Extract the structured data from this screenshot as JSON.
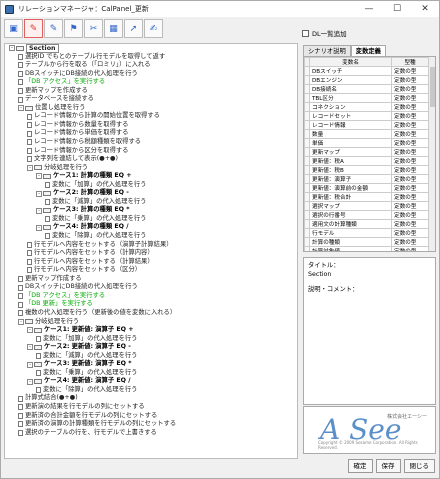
{
  "window": {
    "title": "リレーションマネージャ：CalPanel_更新",
    "ctrl_min": "—",
    "ctrl_max": "☐",
    "ctrl_close": "✕"
  },
  "toolbar": {
    "icons": [
      "folder",
      "record-red",
      "record",
      "flag",
      "tool",
      "grid",
      "cursor",
      "bookmark"
    ]
  },
  "tree": {
    "rows": [
      {
        "lvl": 0,
        "type": "sec",
        "text": "Section",
        "tog": "-"
      },
      {
        "lvl": 1,
        "type": "doc",
        "text": "選択ID でもとのテーブル行モデルを取得して返す"
      },
      {
        "lvl": 1,
        "type": "doc",
        "text": "テーブルから行を取る（「ロミリ」）に入れる"
      },
      {
        "lvl": 1,
        "type": "doc",
        "text": "DBスイッチにDB接続の代入処理を行う"
      },
      {
        "lvl": 1,
        "type": "doc",
        "text": "「DB アクセス」を実行する",
        "hl": true
      },
      {
        "lvl": 1,
        "type": "doc",
        "text": "更新マップを作成する"
      },
      {
        "lvl": 1,
        "type": "doc",
        "text": "データベースを接続する"
      },
      {
        "lvl": 1,
        "type": "fold",
        "text": "位置し処理を行う",
        "tog": "-"
      },
      {
        "lvl": 2,
        "type": "doc",
        "text": "レコード情報から計算の開始位置を取得する"
      },
      {
        "lvl": 2,
        "type": "doc",
        "text": "レコード情報から数量を取得する"
      },
      {
        "lvl": 2,
        "type": "doc",
        "text": "レコード情報から単価を取得する"
      },
      {
        "lvl": 2,
        "type": "doc",
        "text": "レコード情報から税額種類を取得する"
      },
      {
        "lvl": 2,
        "type": "doc",
        "text": "レコード情報から区分を取得する"
      },
      {
        "lvl": 2,
        "type": "doc",
        "text": "文字列を連結して表示(●+●)"
      },
      {
        "lvl": 2,
        "type": "fold",
        "text": "分岐処理を行う",
        "tog": "-"
      },
      {
        "lvl": 3,
        "type": "fold",
        "text": "ケース1: 計算の種類 EQ +",
        "tog": "-",
        "bold": true
      },
      {
        "lvl": 4,
        "type": "doc",
        "text": "変数に「加算」の代入処理を行う"
      },
      {
        "lvl": 3,
        "type": "fold",
        "text": "ケース2: 計算の種類 EQ -",
        "tog": "-",
        "bold": true
      },
      {
        "lvl": 4,
        "type": "doc",
        "text": "変数に「減算」の代入処理を行う"
      },
      {
        "lvl": 3,
        "type": "fold",
        "text": "ケース3: 計算の種類 EQ *",
        "tog": "-",
        "bold": true
      },
      {
        "lvl": 4,
        "type": "doc",
        "text": "変数に「乗算」の代入処理を行う"
      },
      {
        "lvl": 3,
        "type": "fold",
        "text": "ケース4: 計算の種類 EQ /",
        "tog": "-",
        "bold": true
      },
      {
        "lvl": 4,
        "type": "doc",
        "text": "変数に「除算」の代入処理を行う"
      },
      {
        "lvl": 2,
        "type": "doc",
        "text": "行モデルへ内容をセットする（演算子計算結果）"
      },
      {
        "lvl": 2,
        "type": "doc",
        "text": "行モデルへ内容をセットする（計算内容）"
      },
      {
        "lvl": 2,
        "type": "doc",
        "text": "行モデルへ内容をセットする（計算結果）"
      },
      {
        "lvl": 2,
        "type": "doc",
        "text": "行モデルへ内容をセットする（区分）"
      },
      {
        "lvl": 1,
        "type": "doc",
        "text": "更新マップ作成する"
      },
      {
        "lvl": 1,
        "type": "doc",
        "text": "DBスイッチにDB接続の代入処理を行う"
      },
      {
        "lvl": 1,
        "type": "doc",
        "text": "「DB アクセス」を実行する",
        "hl": true
      },
      {
        "lvl": 1,
        "type": "doc",
        "text": "「DB 更新」を実行する",
        "hl": true
      },
      {
        "lvl": 1,
        "type": "doc",
        "text": "複数の代入処理を行う（更新後の値を変数に入れる）"
      },
      {
        "lvl": 1,
        "type": "fold",
        "text": "分岐処理を行う",
        "tog": "-"
      },
      {
        "lvl": 2,
        "type": "fold",
        "text": "ケース1: 更新値: 演算子 EQ +",
        "tog": "-",
        "bold": true
      },
      {
        "lvl": 3,
        "type": "doc",
        "text": "変数に「加算」の代入処理を行う"
      },
      {
        "lvl": 2,
        "type": "fold",
        "text": "ケース2: 更新値: 演算子 EQ -",
        "tog": "-",
        "bold": true
      },
      {
        "lvl": 3,
        "type": "doc",
        "text": "変数に「減算」の代入処理を行う"
      },
      {
        "lvl": 2,
        "type": "fold",
        "text": "ケース3: 更新値: 演算子 EQ *",
        "tog": "-",
        "bold": true
      },
      {
        "lvl": 3,
        "type": "doc",
        "text": "変数に「乗算」の代入処理を行う"
      },
      {
        "lvl": 2,
        "type": "fold",
        "text": "ケース4: 更新値: 演算子 EQ /",
        "tog": "-",
        "bold": true
      },
      {
        "lvl": 3,
        "type": "doc",
        "text": "変数に「除算」の代入処理を行う"
      },
      {
        "lvl": 1,
        "type": "doc",
        "text": "計算式結合(●+●)"
      },
      {
        "lvl": 1,
        "type": "doc",
        "text": "更新演の結果を行モデルの列にセットする"
      },
      {
        "lvl": 1,
        "type": "doc",
        "text": "更新済の合計金額を行モデルの列にセットする"
      },
      {
        "lvl": 1,
        "type": "doc",
        "text": "更新済の演算の計算種類を行モデルの列にセットする"
      },
      {
        "lvl": 1,
        "type": "doc",
        "text": "選択のテーブルの行を、行モデルで上書きする"
      }
    ]
  },
  "right": {
    "dl_checkbox": "DL一覧追加",
    "tabs": [
      "シナリオ説明",
      "変数定義"
    ],
    "grid": {
      "headers": [
        "",
        "変数名",
        "型種"
      ],
      "rows": [
        [
          "",
          "DBスイッチ",
          "定数の型"
        ],
        [
          "",
          "DBエンジン",
          "定数の型"
        ],
        [
          "",
          "DB接続名",
          "定数の型"
        ],
        [
          "",
          "TBL区分",
          "定数の型"
        ],
        [
          "",
          "コネクション",
          "定数の型"
        ],
        [
          "",
          "レコードセット",
          "定数の型"
        ],
        [
          "",
          "レコード情報",
          "定数の型"
        ],
        [
          "",
          "数量",
          "定数の型"
        ],
        [
          "",
          "単価",
          "定数の型"
        ],
        [
          "",
          "更新マップ",
          "定数の型"
        ],
        [
          "",
          "更新値：税A",
          "定数の型"
        ],
        [
          "",
          "更新値：税B",
          "定数の型"
        ],
        [
          "",
          "更新値：演算子",
          "定数の型"
        ],
        [
          "",
          "更新値：演算前の金額",
          "定数の型"
        ],
        [
          "",
          "更新値：税合計",
          "定数の型"
        ],
        [
          "",
          "選択マップ",
          "定数の型"
        ],
        [
          "",
          "選択の行番号",
          "定数の型"
        ],
        [
          "",
          "適用文の計算種類",
          "定数の型"
        ],
        [
          "",
          "行モデル",
          "定数の型"
        ],
        [
          "",
          "計算の種類",
          "定数の型"
        ],
        [
          "",
          "計算対象値",
          "定数の型"
        ],
        [
          "",
          "計算内容",
          "定数の型"
        ]
      ]
    },
    "info_title_label": "タイトル：",
    "info_title_value": "Section",
    "info_comment_label": "説明・コメント：",
    "logo_text": "A See",
    "logo_small": "株式会社エーシー",
    "logo_copy": "Copyright © 2009 Sesame Corporation. All Rights Reserved."
  },
  "buttons": {
    "ok": "確定",
    "save": "保存",
    "close": "閉じる"
  }
}
